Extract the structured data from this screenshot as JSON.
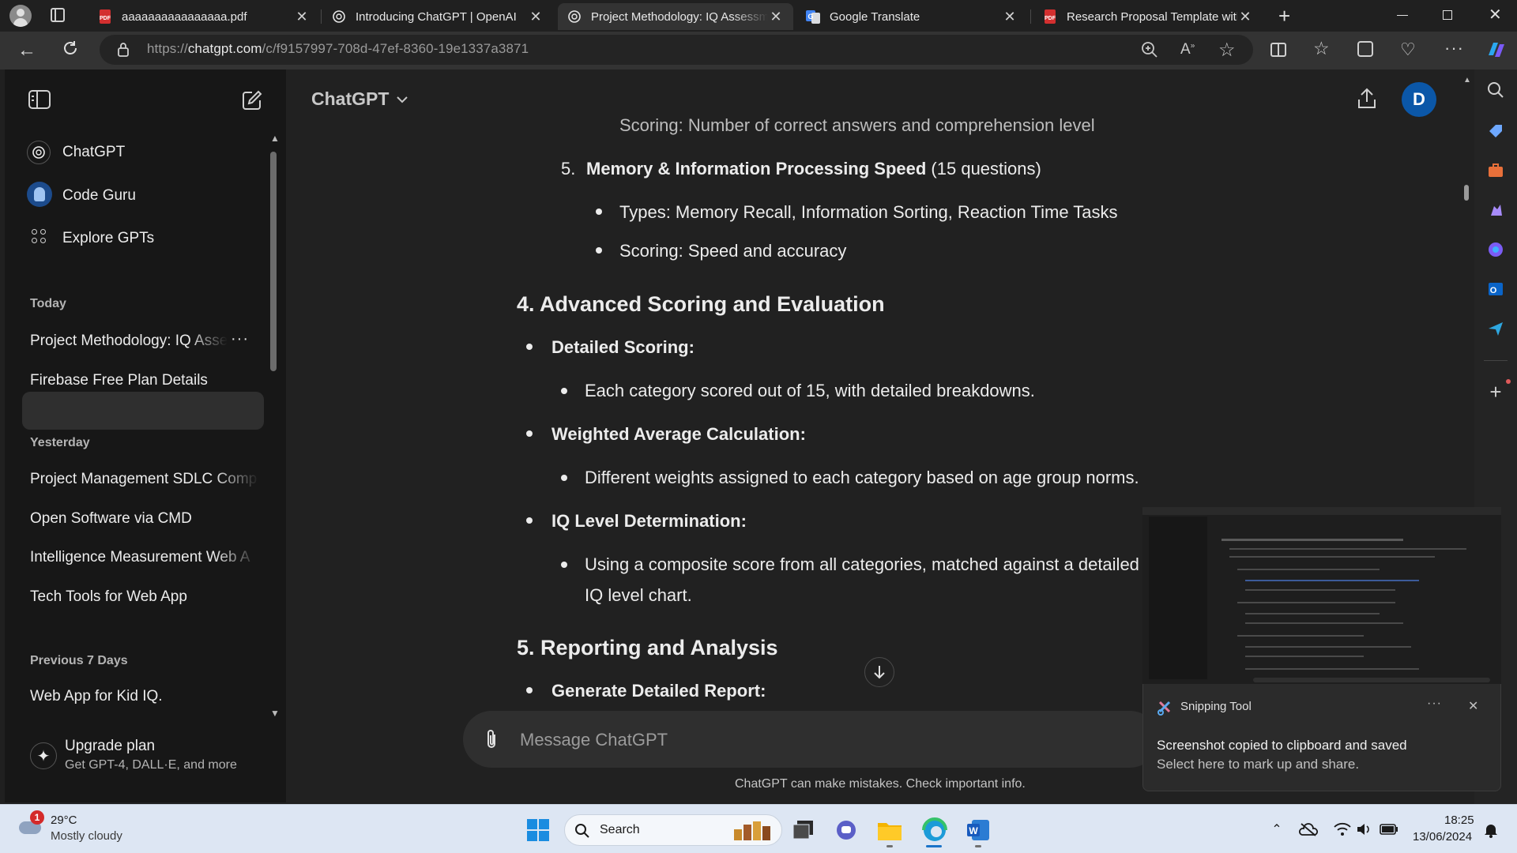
{
  "browser": {
    "tabs": [
      {
        "title": "aaaaaaaaaaaaaaaa.pdf",
        "icon": "pdf-icon"
      },
      {
        "title": "Introducing ChatGPT | OpenAI",
        "icon": "openai-icon"
      },
      {
        "title": "Project Methodology: IQ Assessm",
        "icon": "openai-icon",
        "active": true
      },
      {
        "title": "Google Translate",
        "icon": "google-translate-icon"
      },
      {
        "title": "Research Proposal Template with",
        "icon": "pdf-icon"
      }
    ],
    "url_prefix": "https://",
    "url_domain": "chatgpt.com",
    "url_path": "/c/f9157997-708d-47ef-8360-19e1337a3871"
  },
  "sidebar": {
    "gpts": [
      {
        "label": "ChatGPT",
        "icon": "chatgpt-icon"
      },
      {
        "label": "Code Guru",
        "icon": "code-guru-avatar"
      },
      {
        "label": "Explore GPTs",
        "icon": "grid-icon"
      }
    ],
    "today_heading": "Today",
    "today": [
      "Project Methodology: IQ Asse",
      "Firebase Free Plan Details"
    ],
    "yesterday_heading": "Yesterday",
    "yesterday": [
      "Project Management SDLC Comp",
      "Open Software via CMD",
      "Intelligence Measurement Web A",
      "Tech Tools for Web App"
    ],
    "prev7_heading": "Previous 7 Days",
    "prev7": [
      "Web App for Kid IQ."
    ],
    "upgrade_title": "Upgrade plan",
    "upgrade_subtitle": "Get GPT-4, DALL·E, and more"
  },
  "header": {
    "model": "ChatGPT",
    "avatar_letter": "D"
  },
  "content": {
    "cutoff_line": "Scoring: Number of correct answers and comprehension level",
    "item5_num": "5.",
    "item5_title": "Memory & Information Processing Speed",
    "item5_count": " (15 questions)",
    "item5_types": "Types: Memory Recall, Information Sorting, Reaction Time Tasks",
    "item5_scoring": "Scoring: Speed and accuracy",
    "section4": "4. Advanced Scoring and Evaluation",
    "detailed_scoring": "Detailed Scoring:",
    "detailed_scoring_text": "Each category scored out of 15, with detailed breakdowns.",
    "weighted": "Weighted Average Calculation:",
    "weighted_text": "Different weights assigned to each category based on age group norms.",
    "iq_level": "IQ Level Determination:",
    "iq_level_text1": "Using a composite score from all categories, matched against a detailed",
    "iq_level_text2": "IQ level chart.",
    "section5": "5. Reporting and Analysis",
    "generate_report": "Generate Detailed Report:"
  },
  "composer": {
    "placeholder": "Message ChatGPT",
    "disclaimer": "ChatGPT can make mistakes. Check important info."
  },
  "toast": {
    "app": "Snipping Tool",
    "title": "Screenshot copied to clipboard and saved",
    "subtitle": "Select here to mark up and share."
  },
  "taskbar": {
    "weather_temp": "29°C",
    "weather_desc": "Mostly cloudy",
    "weather_badge": "1",
    "search": "Search",
    "time": "18:25",
    "date": "13/06/2024"
  },
  "colors": {
    "page_bg": "#212121",
    "sidebar_bg": "#171717",
    "avatar": "#0b57a8",
    "accent_blue": "#0078d4"
  }
}
